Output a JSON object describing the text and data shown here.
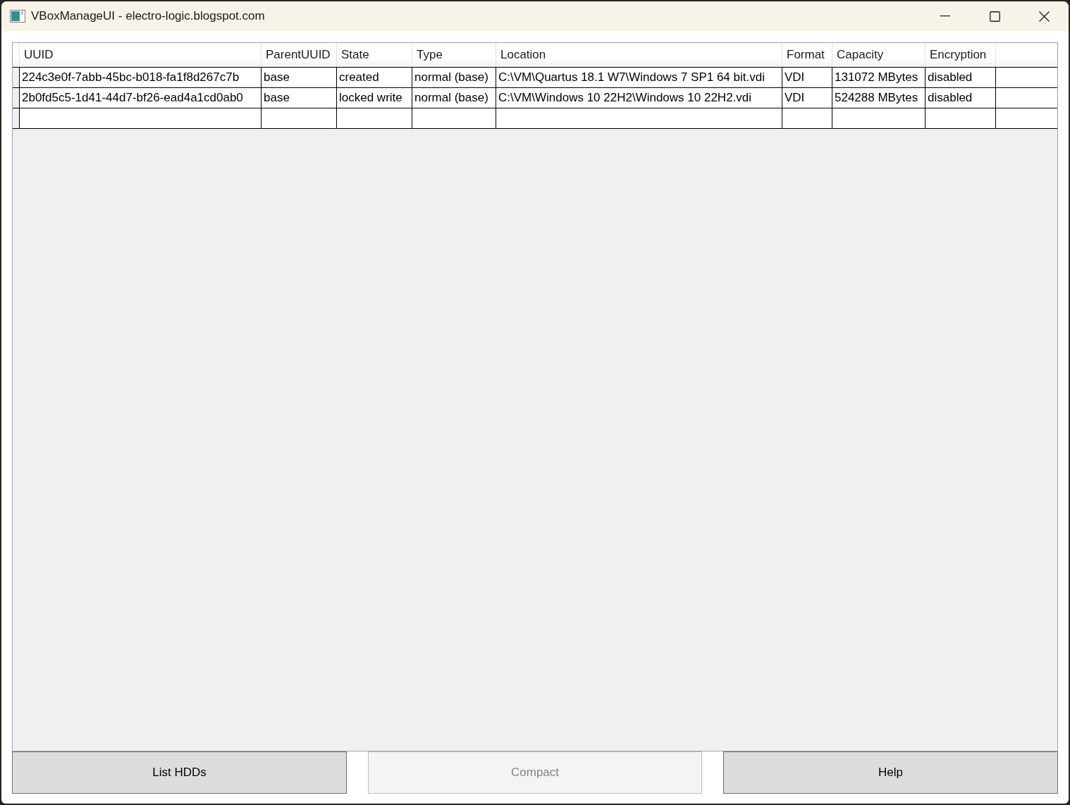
{
  "window": {
    "title": "VBoxManageUI - electro-logic.blogspot.com"
  },
  "table": {
    "columns": [
      "UUID",
      "ParentUUID",
      "State",
      "Type",
      "Location",
      "Format",
      "Capacity",
      "Encryption"
    ],
    "rows": [
      [
        "224c3e0f-7abb-45bc-b018-fa1f8d267c7b",
        "base",
        "created",
        "normal (base)",
        "C:\\VM\\Quartus 18.1 W7\\Windows 7 SP1 64 bit.vdi",
        "VDI",
        "131072 MBytes",
        "disabled"
      ],
      [
        "2b0fd5c5-1d41-44d7-bf26-ead4a1cd0ab0",
        "base",
        "locked write",
        "normal (base)",
        "C:\\VM\\Windows 10 22H2\\Windows 10 22H2.vdi",
        "VDI",
        "524288 MBytes",
        "disabled"
      ]
    ]
  },
  "buttons": [
    {
      "label": "List HDDs",
      "disabled": false
    },
    {
      "label": "Compact",
      "disabled": true
    },
    {
      "label": "Help",
      "disabled": false
    }
  ]
}
